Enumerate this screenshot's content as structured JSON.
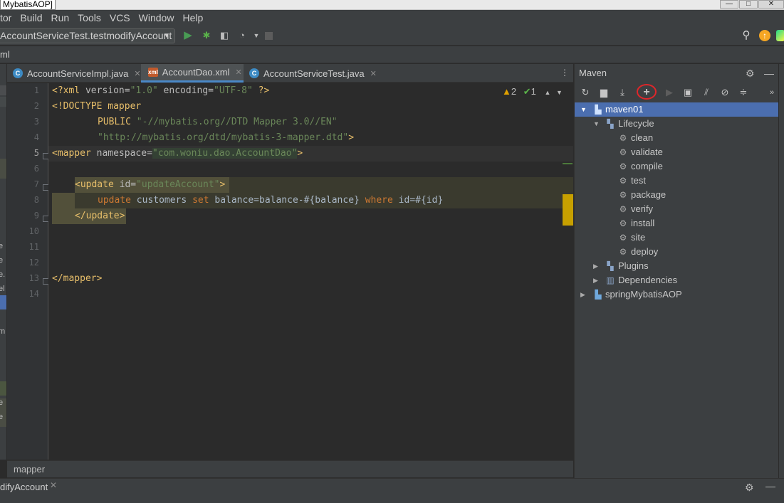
{
  "window": {
    "title": "MybatisAOP]",
    "controls": [
      "—",
      "□",
      "✕"
    ]
  },
  "menu": [
    "tor",
    "Build",
    "Run",
    "Tools",
    "VCS",
    "Window",
    "Help"
  ],
  "toolbar": {
    "run_config": "AccountServiceTest.testmodifyAccount",
    "icons": [
      "run-icon",
      "debug-icon",
      "coverage-icon",
      "profile-icon",
      "stop-icon",
      "search-icon",
      "update-icon",
      "jetbrains-icon"
    ]
  },
  "navbar": {
    "crumb": "ml"
  },
  "left_stub": [
    "e",
    "e",
    "e.",
    "el",
    "m",
    "l",
    "e",
    "e"
  ],
  "tabs": [
    {
      "label": "AccountServiceImpl.java",
      "icon": "C",
      "type": "java",
      "active": false
    },
    {
      "label": "AccountDao.xml",
      "icon": "xml",
      "type": "xml",
      "active": true
    },
    {
      "label": "AccountServiceTest.java",
      "icon": "C",
      "type": "java",
      "active": false
    }
  ],
  "editor": {
    "line_numbers": [
      "1",
      "2",
      "3",
      "4",
      "5",
      "6",
      "7",
      "8",
      "9",
      "10",
      "11",
      "12",
      "13",
      "14"
    ],
    "current_line": 5,
    "inspections": {
      "warnings": "2",
      "ok": "1"
    },
    "lines": {
      "l1": {
        "a": "<?xml",
        "b": " version=",
        "c": "\"1.0\"",
        "d": " encoding=",
        "e": "\"UTF-8\"",
        "f": " ?>"
      },
      "l2": {
        "a": "<!DOCTYPE mapper"
      },
      "l3": {
        "a": "PUBLIC ",
        "b": "\"-//mybatis.org//DTD Mapper 3.0//EN\""
      },
      "l4": {
        "a": "\"http://mybatis.org/dtd/mybatis-3-mapper.dtd\"",
        "b": ">"
      },
      "l5": {
        "a": "<mapper",
        "b": " namespace=",
        "c": "\"",
        "d": "com.woniu.dao.AccountDao",
        "e": "\"",
        "f": ">"
      },
      "l7": {
        "a": "<update",
        "b": " id=",
        "c": "\"updateAccount\"",
        "d": ">"
      },
      "l8": {
        "a": "update",
        "b": " customers ",
        "c": "set",
        "d": " balance=balance-#{balance} ",
        "e": "where",
        "f": " id=#{id}"
      },
      "l9": {
        "a": "</update>"
      },
      "l13": {
        "a": "</mapper>"
      }
    }
  },
  "statusbar": {
    "crumb": "mapper"
  },
  "bottombar": {
    "label": "difyAccount"
  },
  "maven": {
    "title": "Maven",
    "toolbar_icons": [
      "reload-icon",
      "add-folder-icon",
      "download-icon",
      "add-icon",
      "run-icon",
      "execute-goal-icon",
      "toggle-offline-icon",
      "skip-tests-icon",
      "collapse-icon",
      "more-icon"
    ],
    "tree": {
      "root": "maven01",
      "lifecycle": "Lifecycle",
      "goals": [
        "clean",
        "validate",
        "compile",
        "test",
        "package",
        "verify",
        "install",
        "site",
        "deploy"
      ],
      "plugins": "Plugins",
      "dependencies": "Dependencies",
      "other_root": "springMybatisAOP"
    }
  }
}
